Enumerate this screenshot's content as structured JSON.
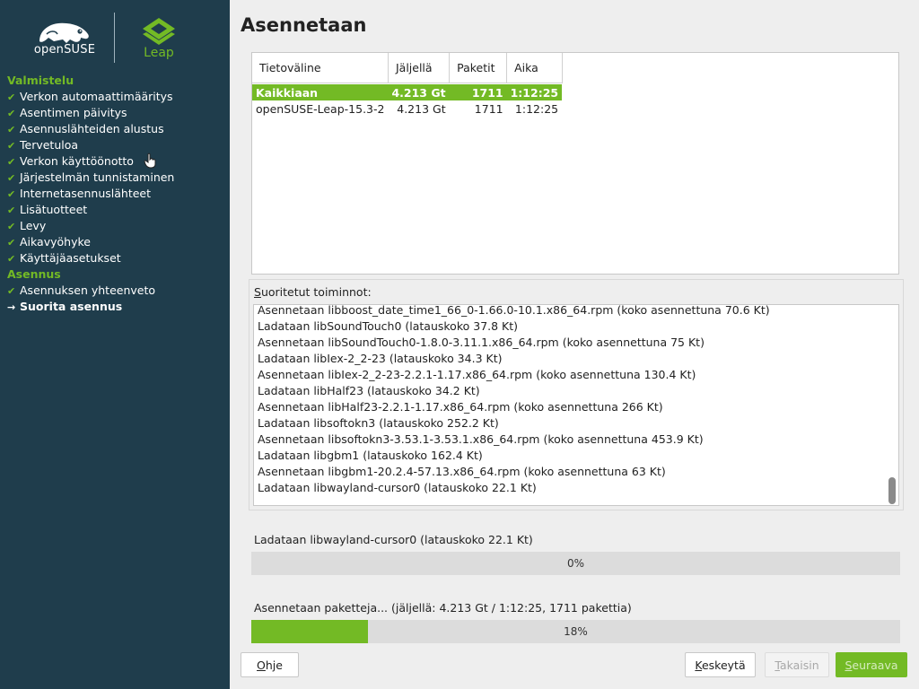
{
  "sidebar": {
    "logo_text": "openSUSE",
    "leap_text": "Leap",
    "sections": [
      {
        "title": "Valmistelu",
        "steps": [
          "Verkon automaattimääritys",
          "Asentimen päivitys",
          "Asennuslähteiden alustus",
          "Tervetuloa",
          "Verkon käyttöönotto",
          "Järjestelmän tunnistaminen",
          "Internetasennuslähteet",
          "Lisätuotteet",
          "Levy",
          "Aikavyöhyke",
          "Käyttäjäasetukset"
        ]
      },
      {
        "title": "Asennus",
        "steps": [
          "Asennuksen yhteenveto",
          "Suorita asennus"
        ]
      }
    ],
    "done_mark": "✔",
    "current_mark": "→"
  },
  "page_title": "Asennetaan",
  "media_table": {
    "headers": [
      "Tietoväline",
      "Jäljellä",
      "Paketit",
      "Aika"
    ],
    "rows": [
      [
        "Kaikkiaan",
        "4.213 Gt",
        "1711",
        "1:12:25"
      ],
      [
        "openSUSE-Leap-15.3-2",
        "4.213 Gt",
        "1711",
        "1:12:25"
      ]
    ]
  },
  "log": {
    "label_accel": "S",
    "label_rest": "uoritetut toiminnot:",
    "lines": [
      "Asennetaan libboost_date_time1_66_0-1.66.0-10.1.x86_64.rpm (koko asennettuna 70.6 Kt)",
      "Ladataan libSoundTouch0 (latauskoko 37.8 Kt)",
      "Asennetaan libSoundTouch0-1.8.0-3.11.1.x86_64.rpm (koko asennettuna 75 Kt)",
      "Ladataan libIex-2_2-23 (latauskoko 34.3 Kt)",
      "Asennetaan libIex-2_2-23-2.2.1-1.17.x86_64.rpm (koko asennettuna 130.4 Kt)",
      "Ladataan libHalf23 (latauskoko 34.2 Kt)",
      "Asennetaan libHalf23-2.2.1-1.17.x86_64.rpm (koko asennettuna 266 Kt)",
      "Ladataan libsoftokn3 (latauskoko 252.2 Kt)",
      "Asennetaan libsoftokn3-3.53.1-3.53.1.x86_64.rpm (koko asennettuna 453.9 Kt)",
      "Ladataan libgbm1 (latauskoko 162.4 Kt)",
      "Asennetaan libgbm1-20.2.4-57.13.x86_64.rpm (koko asennettuna 63 Kt)",
      "Ladataan libwayland-cursor0 (latauskoko 22.1 Kt)"
    ]
  },
  "package_progress": {
    "label": "Ladataan libwayland-cursor0 (latauskoko 22.1 Kt)",
    "percent": 0,
    "percent_text": "0%"
  },
  "total_progress": {
    "label": "Asennetaan paketteja... (jäljellä: 4.213 Gt / 1:12:25, 1711 pakettia)",
    "percent": 18,
    "percent_text": "18%"
  },
  "buttons": {
    "help": {
      "accel": "O",
      "rest": "hje"
    },
    "abort": {
      "accel": "K",
      "rest": "eskeytä"
    },
    "back": {
      "accel": "T",
      "rest": "akaisin"
    },
    "next": {
      "accel": "S",
      "rest": "euraava"
    }
  },
  "colors": {
    "sidebar_bg": "#1f3d4c",
    "accent_green": "#73ba25"
  }
}
